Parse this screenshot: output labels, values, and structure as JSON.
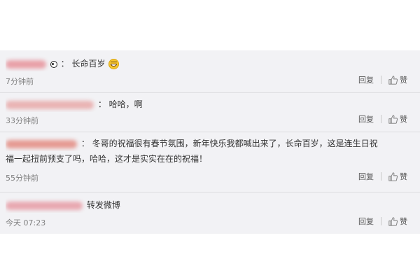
{
  "comments": [
    {
      "text": "长命百岁",
      "time": "7分钟前",
      "blur_color": "#e8a0a8",
      "has_panda": true,
      "has_emoji": true,
      "emoji": "laughing-face"
    },
    {
      "text": "哈哈，啊",
      "time": "33分钟前",
      "blur_color": "#e9b3b3",
      "has_panda": false,
      "has_emoji": false
    },
    {
      "text": "冬哥的祝福很有春节氛围，新年快乐我都喊出来了，长命百岁，这是连生日祝",
      "text_line2": "福一起扭前预支了吗，哈哈，这才是实实在在的祝福！",
      "time": "55分钟前",
      "blur_color": "#e59a92",
      "has_panda": false,
      "has_emoji": false
    },
    {
      "text": "转发微博",
      "time": "今天 07:23",
      "blur_color": "#e8a8b0",
      "has_panda": false,
      "has_emoji": false
    }
  ],
  "actions": {
    "reply_label": "回复",
    "like_label": "赞"
  },
  "separator": "："
}
